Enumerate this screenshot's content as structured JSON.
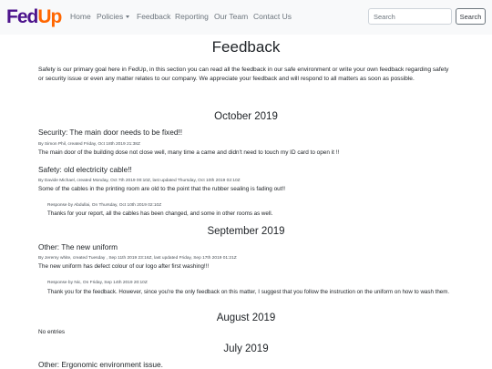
{
  "nav": {
    "brand_fed": "Fed",
    "brand_up": "Up",
    "links": {
      "home": "Home",
      "policies": "Policies",
      "feedback": "Feedback",
      "reporting": "Reporting",
      "our_team": "Our Team",
      "contact_us": "Contact Us"
    },
    "search_placeholder": "Search",
    "search_button": "Search",
    "colors": {
      "fed": "#4d148c",
      "up": "#ff6600"
    }
  },
  "page": {
    "title": "Feedback",
    "intro": "Safety is our primary goal here in FedUp, in this section you can read all the feedback in our safe environment or write your own feedback regarding safety or security issue or even any matter relates to our company. We appreciate your feedback and will respond to all matters as soon as possible."
  },
  "months": [
    {
      "label": "October 2019",
      "posts": [
        {
          "title": "Security: The main door needs to be fixed!!",
          "meta": "By Simon Phil, created Friday, Oct 18th 2019 21:38Z",
          "body": "The main door of the building dose not close well, many time a came and didn't need to touch my ID card to open it !!"
        },
        {
          "title": "Safety: old electricity cable!!",
          "meta": "By Davide Michael, created Monday, Oct 7th 2019 00:10Z, last updated Thursday, Oct 10th 2019 02:10Z",
          "body": "Some of the cables in the printing room are old to the point that the rubber sealing is fading out!!",
          "response_meta": "Response by Abdullai, On Thursday, Oct 10th 2019 02:10Z",
          "response_body": "Thanks for your report, all the cables has been changed, and some in other rooms as well."
        }
      ]
    },
    {
      "label": "September 2019",
      "posts": [
        {
          "title": "Other: The new uniform",
          "meta": "By Jeremy white, created Tuesday , Sep 11th 2019 23:16Z, last updated Friday, Sep 17th 2019 01:21Z",
          "body": "The new uniform has defect colour of our logo after first washing!!!",
          "response_meta": "Response by Nic, On Friday, Sep 14th 2019 20:10Z",
          "response_body": "Thank you for the feedback. However, since you're the only feedback on this matter, I suggest that you follow the instruction on the uniform on how to wash them."
        }
      ]
    },
    {
      "label": "August 2019",
      "empty": "No entries"
    },
    {
      "label": "July 2019",
      "posts": [
        {
          "title": "Other: Ergonomic environment issue."
        }
      ]
    }
  ]
}
